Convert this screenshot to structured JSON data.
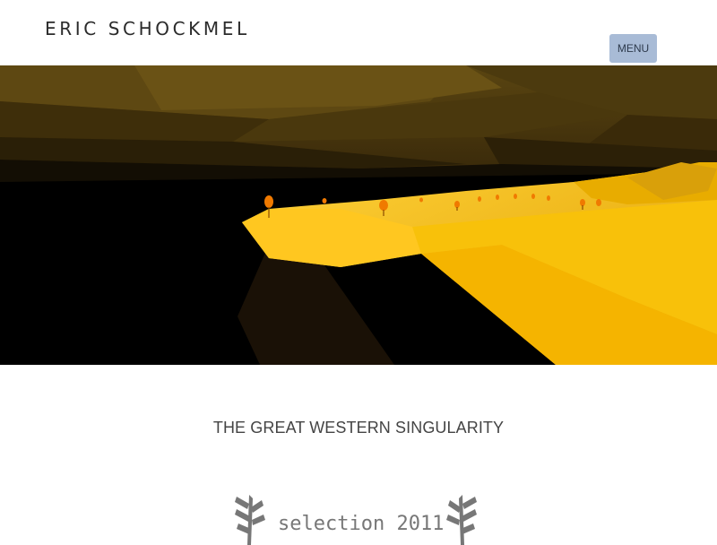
{
  "header": {
    "site_title": "ERIC SCHOCKMEL",
    "menu_label": "MENU"
  },
  "hero": {
    "description_icon": "low-poly-landscape-image"
  },
  "main": {
    "film_title": "THE GREAT WESTERN SINGULARITY",
    "laurel": {
      "text": "selection 2011",
      "icon": "laurel-icon"
    }
  },
  "colors": {
    "menu_bg": "#a8bbd6",
    "title_text": "#444444",
    "laurel_gray": "#777777",
    "landscape_yellow": "#f0b800"
  }
}
